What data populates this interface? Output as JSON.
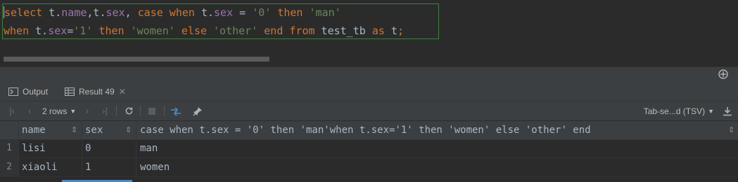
{
  "editor": {
    "line1": {
      "t1": "select",
      "t2": " t.",
      "t3": "name",
      "t4": ",t.",
      "t5": "sex",
      "t6": ", ",
      "t7": "case when",
      "t8": " t.",
      "t9": "sex",
      "t10": " = ",
      "t11": "'0'",
      "t12": " ",
      "t13": "then",
      "t14": " ",
      "t15": "'man'"
    },
    "line2": {
      "t1": "when",
      "t2": " t.",
      "t3": "sex",
      "t4": "=",
      "t5": "'1'",
      "t6": " ",
      "t7": "then",
      "t8": " ",
      "t9": "'women'",
      "t10": " ",
      "t11": "else",
      "t12": " ",
      "t13": "'other'",
      "t14": " ",
      "t15": "end from",
      "t16": " test_tb ",
      "t17": "as",
      "t18": " t",
      "t19": ";"
    }
  },
  "colors": {
    "keyword": "#cc7832",
    "field": "#9876aa",
    "string": "#6a8759",
    "text": "#a9b7c6",
    "accent": "#4a88c7"
  },
  "tabs": {
    "output": {
      "label": "Output",
      "icon": "console-icon"
    },
    "result": {
      "label": "Result 49",
      "icon": "table-icon"
    }
  },
  "toolbar": {
    "rows": "2 rows",
    "format": "Tab-se...d (TSV)"
  },
  "grid": {
    "headers": [
      "name",
      "sex",
      "case when t.sex = '0' then 'man'when t.sex='1' then 'women' else 'other' end"
    ],
    "rows": [
      {
        "num": "1",
        "cells": [
          "lisi",
          "0",
          "man"
        ]
      },
      {
        "num": "2",
        "cells": [
          "xiaoli",
          "1",
          "women"
        ]
      }
    ]
  }
}
